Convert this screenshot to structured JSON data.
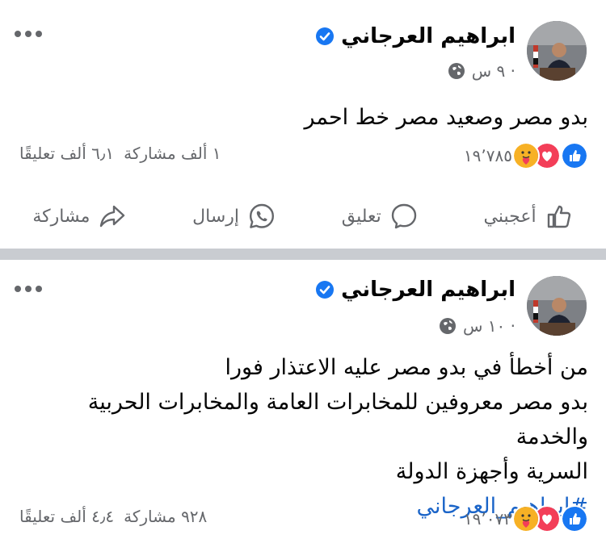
{
  "posts": [
    {
      "author": "ابراهيم العرجاني",
      "time": "٩ س ·",
      "text": [
        "بدو مصر وصعيد مصر خط احمر"
      ],
      "reaction_count": "١٩٬٧٨٥",
      "comments": "٦٫١ ألف تعليقًا",
      "shares": "١ ألف مشاركة",
      "actions": {
        "like": "أعجبني",
        "comment": "تعليق",
        "send": "إرسال",
        "share": "مشاركة"
      }
    },
    {
      "author": "ابراهيم العرجاني",
      "time": "١٠ س ·",
      "text": [
        "من أخطأ في بدو مصر عليه الاعتذار فورا",
        "بدو مصر معروفين للمخابرات العامة والمخابرات الحربية والخدمة",
        "السرية وأجهزة الدولة"
      ],
      "hashtag": "#ابراهيم_العرجاني",
      "reaction_count": "١٩٬٠٧٣",
      "comments": "٤٫٤ ألف تعليقًا",
      "shares": "٩٢٨ مشاركة"
    }
  ],
  "colors": {
    "like_blue": "#1877f2",
    "love_red": "#f33e58",
    "care_yellow": "#f7b125",
    "secondary_text": "#65676b",
    "hashtag": "#1a64c8"
  },
  "icons": [
    "verified-badge-icon",
    "globe-icon",
    "more-icon",
    "like-icon",
    "love-icon",
    "care-icon",
    "thumbs-up-icon",
    "comment-icon",
    "whatsapp-icon",
    "share-icon"
  ]
}
